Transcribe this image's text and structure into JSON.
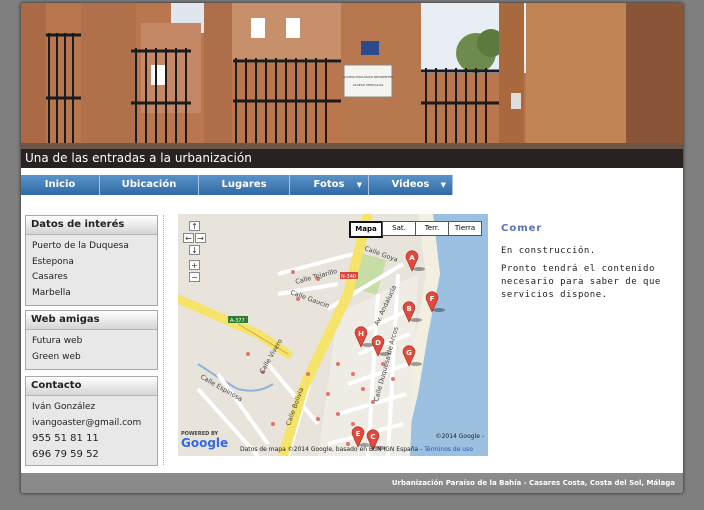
{
  "banner": {
    "caption": "Una de las entradas a la urbanización",
    "sign_text": [
      "ACCESO EXCLUSIVO RESIDENTES",
      "ACCESO VEHICULOS"
    ]
  },
  "nav": {
    "items": [
      {
        "label": "Inicio",
        "dropdown": false
      },
      {
        "label": "Ubicación",
        "dropdown": false
      },
      {
        "label": "Lugares",
        "dropdown": false
      },
      {
        "label": "Fotos",
        "dropdown": true
      },
      {
        "label": "Videos",
        "dropdown": true
      }
    ]
  },
  "sidebar": {
    "interest": {
      "title": "Datos de interés",
      "items": [
        "Puerto de la Duquesa",
        "Estepona",
        "Casares",
        "Marbella"
      ]
    },
    "webs": {
      "title": "Web amigas",
      "items": [
        "Futura web",
        "Green web"
      ]
    },
    "contact": {
      "title": "Contacto",
      "items": [
        "Iván González",
        "ivangoaster@gmail.com",
        "955 51 81 11",
        "696 79 59 52"
      ]
    }
  },
  "map": {
    "types": [
      "Mapa",
      "Sat.",
      "Terr.",
      "Tierra"
    ],
    "selected_type": "Mapa",
    "zoom_controls": [
      "↑",
      "←",
      "→",
      "↓",
      "+",
      "−"
    ],
    "street_labels": [
      "Calle Goya",
      "N-340",
      "Calle Tejarillo",
      "Calle Gaucin",
      "A-377",
      "Av. Andalucía",
      "Calle Duquesa de Arcos",
      "Calle Espinosa",
      "Calle Bolivia",
      "Calle Vivero"
    ],
    "markers": [
      "A",
      "B",
      "F",
      "H",
      "D",
      "G",
      "E",
      "C"
    ],
    "powered_by": "POWERED BY",
    "google": "Google",
    "copyright_top": "©2014 Google -",
    "copyright_bottom": "Datos de mapa ©2014 Google, basado en BCN IGN España -",
    "terms": "Términos de uso"
  },
  "content": {
    "title": "Comer",
    "paragraph1": "En construcción.",
    "paragraph2": "Pronto tendrá el contenido necesario para saber de que servicios dispone."
  },
  "footer": {
    "text": "Urbanización Paraíso de la Bahía - Casares Costa, Costa del Sol, Málaga"
  },
  "colors": {
    "nav": "#3a78b5",
    "accent_title": "#5b71b8",
    "marker": "#e34a3c",
    "road_yellow": "#f5e36a",
    "sea": "#9cc0e0"
  }
}
